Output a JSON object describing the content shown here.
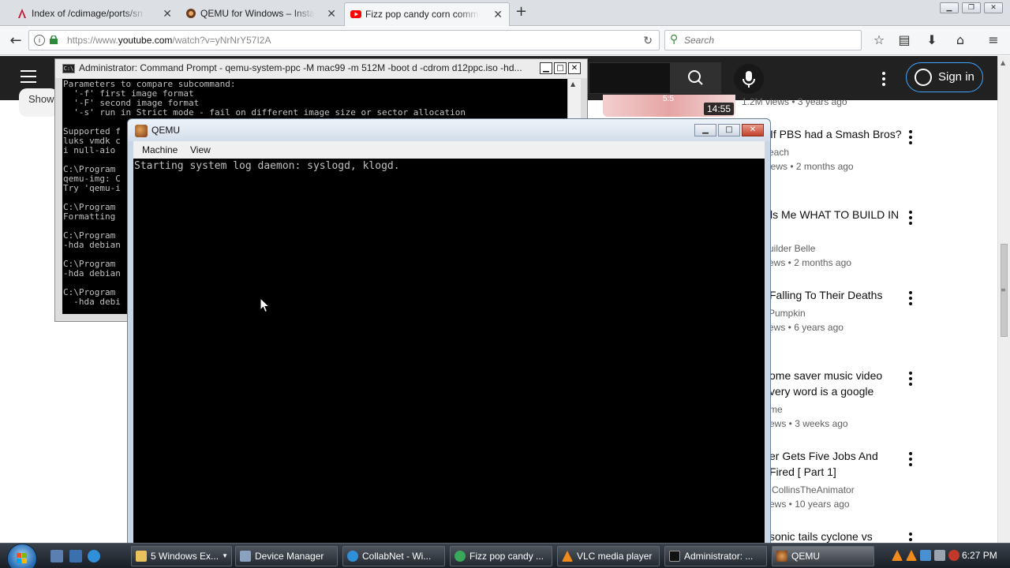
{
  "browser": {
    "tabs": [
      {
        "label": "Index of /cdimage/ports/sn"
      },
      {
        "label": "QEMU for Windows – Install"
      },
      {
        "label": "Fizz pop candy corn comme"
      }
    ],
    "url_prefix": "https://www.",
    "url_host": "youtube.com",
    "url_rest": "/watch?v=yNrNrY57I2A",
    "search_placeholder": "Search"
  },
  "youtube": {
    "sign_in": "Sign in",
    "show_chip": "Show",
    "thumb_badge": "5:5",
    "thumb_duration": "14:55",
    "top_stats": "1.2M views • 3 years ago",
    "videos": [
      {
        "title": "If PBS had a Smash Bros?",
        "title2": "",
        "channel": "each",
        "stats": "iews • 2 months ago"
      },
      {
        "title": "ls Me WHAT TO BUILD IN",
        "title2": "",
        "channel": "uilder Belle",
        "stats": "ews • 2 months ago"
      },
      {
        "title": "Falling To Their Deaths",
        "title2": "",
        "channel": "Pumpkin",
        "stats": "ews • 6 years ago"
      },
      {
        "title": "ome saver music video",
        "title2": "very word is a google",
        "channel": "me",
        "stats": "ews • 3 weeks ago"
      },
      {
        "title": "er Gets Five Jobs And",
        "title2": "Fired [ Part 1]",
        "channel": "CollinsTheAnimator",
        "stats": "ews • 10 years ago"
      },
      {
        "title": "sonic tails cyclone vs",
        "title2": "",
        "channel": "",
        "stats": ""
      }
    ]
  },
  "cmd": {
    "title": "Administrator: Command Prompt - qemu-system-ppc  -M mac99 -m 512M -boot d -cdrom d12ppc.iso  -hd...",
    "lines": [
      "Parameters to compare subcommand:",
      "  '-f' first image format",
      "  '-F' second image format",
      "  '-s' run in Strict mode - fail on different image size or sector allocation",
      "",
      "Supported f",
      "luks vmdk c",
      "i null-aio",
      "",
      "C:\\Program",
      "qemu-img: C",
      "Try 'qemu-i",
      "",
      "C:\\Program",
      "Formatting",
      "",
      "C:\\Program",
      "-hda debian",
      "",
      "C:\\Program",
      "-hda debian",
      "",
      "C:\\Program",
      "  -hda debi"
    ]
  },
  "qemu": {
    "title": "QEMU",
    "menu_machine": "Machine",
    "menu_view": "View",
    "console": "Starting system log daemon: syslogd, klogd."
  },
  "taskbar": {
    "buttons": [
      {
        "label": "5 Windows Ex..."
      },
      {
        "label": "Device Manager"
      },
      {
        "label": "CollabNet - Wi..."
      },
      {
        "label": "Fizz pop candy ..."
      },
      {
        "label": "VLC media player"
      },
      {
        "label": "Administrator: ..."
      },
      {
        "label": "QEMU"
      }
    ],
    "clock": "6:27 PM"
  },
  "colors": {
    "yt_dark": "#212121",
    "accent_blue": "#3ea6ff",
    "tab_youtube_red": "#ff0000",
    "console_text": "#c0c0c0"
  }
}
